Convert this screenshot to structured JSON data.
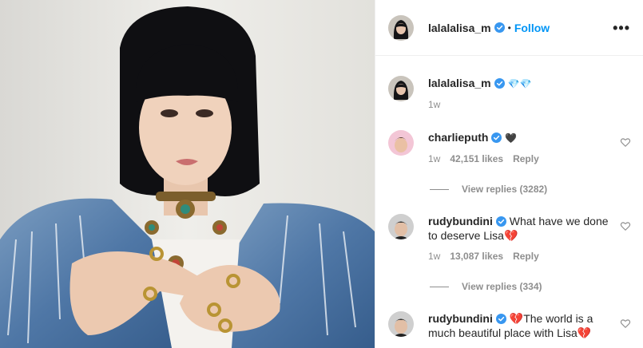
{
  "post": {
    "author": "lalalalisa_m",
    "follow_label": "Follow",
    "separator": "•",
    "more_label": "•••"
  },
  "caption": {
    "username": "lalalalisa_m",
    "text": "💎💎",
    "time": "1w"
  },
  "comments": [
    {
      "username": "charlieputh",
      "text": "🖤",
      "time": "1w",
      "likes": "42,151 likes",
      "reply_label": "Reply",
      "view_replies": "View replies (3282)"
    },
    {
      "username": "rudybundini",
      "text": "What have we done to deserve Lisa💔",
      "time": "1w",
      "likes": "13,087 likes",
      "reply_label": "Reply",
      "view_replies": "View replies (334)"
    },
    {
      "username": "rudybundini",
      "text": "💔The world is a much beautiful place with Lisa💔"
    }
  ],
  "colors": {
    "accent": "#0095f6",
    "verified": "#3897f0",
    "muted": "#8e8e8e"
  },
  "icons": {
    "verified": "verified-badge-icon",
    "heart": "heart-outline-icon",
    "more": "more-horizontal-icon"
  }
}
